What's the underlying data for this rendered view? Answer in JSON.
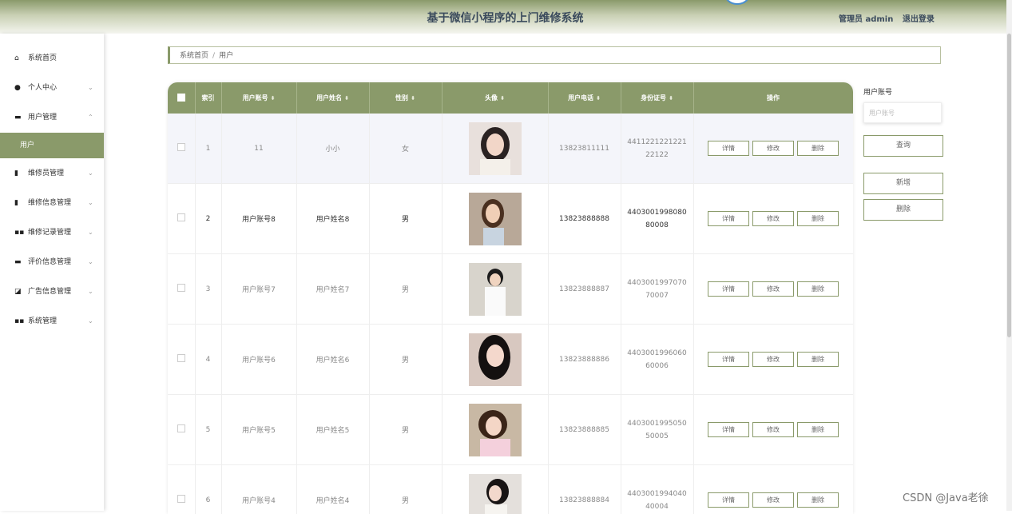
{
  "header": {
    "title": "基于微信小程序的上门维修系统",
    "user": "管理员 admin",
    "logout": "退出登录"
  },
  "sidebar": {
    "items": [
      {
        "label": "系统首页",
        "icon": "home-icon"
      },
      {
        "label": "个人中心",
        "icon": "user-icon"
      },
      {
        "label": "用户管理",
        "icon": "monitor-icon"
      },
      {
        "label": "维修员管理",
        "icon": "clipboard-icon"
      },
      {
        "label": "维修信息管理",
        "icon": "clipboard-check-icon"
      },
      {
        "label": "维修记录管理",
        "icon": "grid-icon"
      },
      {
        "label": "评价信息管理",
        "icon": "briefcase-icon"
      },
      {
        "label": "广告信息管理",
        "icon": "chart-icon"
      },
      {
        "label": "系统管理",
        "icon": "grid-icon"
      }
    ],
    "active_sub": "用户"
  },
  "breadcrumb": {
    "home": "系统首页",
    "sep": "/",
    "current": "用户"
  },
  "table": {
    "columns": [
      "索引",
      "用户账号",
      "用户姓名",
      "性别",
      "头像",
      "用户电话",
      "身份证号",
      "操作"
    ],
    "actions": {
      "detail": "详情",
      "edit": "修改",
      "delete": "删除"
    },
    "rows": [
      {
        "index": "1",
        "account": "11",
        "name": "小小",
        "gender": "女",
        "phone": "13823811111",
        "id1": "4411221221221",
        "id2": "22122"
      },
      {
        "index": "2",
        "account": "用户账号8",
        "name": "用户姓名8",
        "gender": "男",
        "phone": "13823888888",
        "id1": "4403001998080",
        "id2": "80008"
      },
      {
        "index": "3",
        "account": "用户账号7",
        "name": "用户姓名7",
        "gender": "男",
        "phone": "13823888887",
        "id1": "4403001997070",
        "id2": "70007"
      },
      {
        "index": "4",
        "account": "用户账号6",
        "name": "用户姓名6",
        "gender": "男",
        "phone": "13823888886",
        "id1": "4403001996060",
        "id2": "60006"
      },
      {
        "index": "5",
        "account": "用户账号5",
        "name": "用户姓名5",
        "gender": "男",
        "phone": "13823888885",
        "id1": "4403001995050",
        "id2": "50005"
      },
      {
        "index": "6",
        "account": "用户账号4",
        "name": "用户姓名4",
        "gender": "男",
        "phone": "13823888884",
        "id1": "4403001994040",
        "id2": "40004"
      }
    ]
  },
  "search": {
    "label": "用户账号",
    "placeholder": "用户账号",
    "query": "查询",
    "add": "新增",
    "delete": "删除"
  },
  "watermark": "CSDN @Java老徐"
}
